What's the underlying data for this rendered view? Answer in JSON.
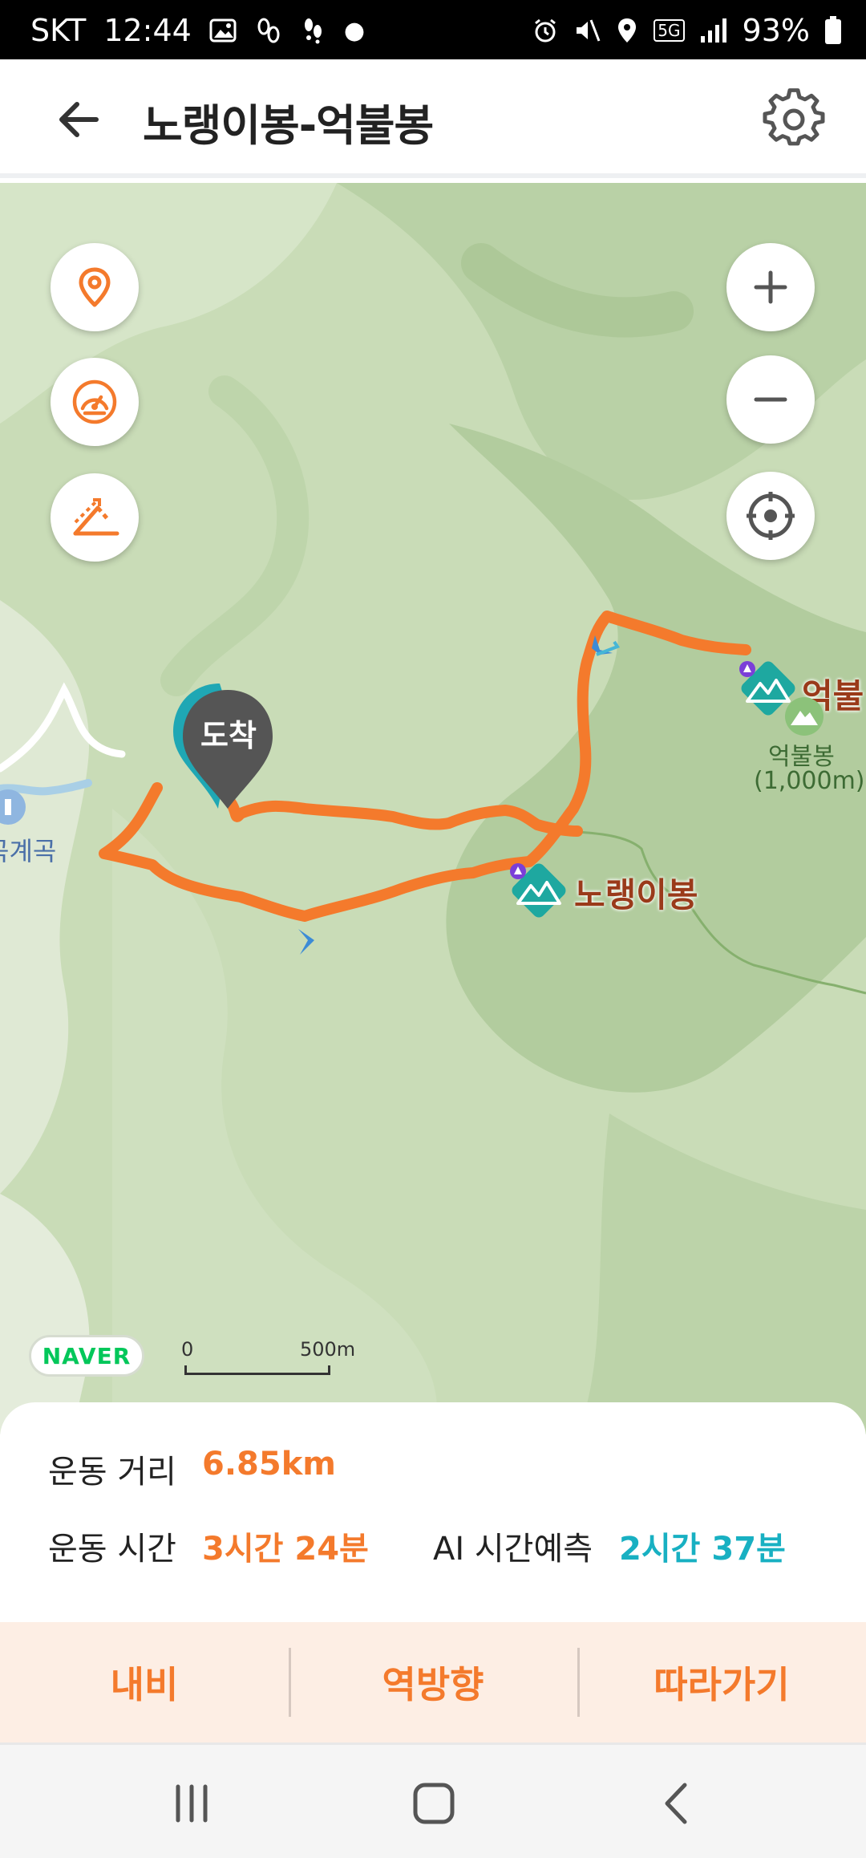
{
  "status_bar": {
    "carrier": "SKT",
    "time": "12:44",
    "network": "5G",
    "battery": "93%"
  },
  "header": {
    "title": "노랭이봉-억불봉",
    "back_icon": "arrow-left-icon",
    "settings_icon": "gear-icon"
  },
  "map": {
    "arrival_pin": "도착",
    "peaks": {
      "noraengi": "노랭이봉",
      "eokbul_short": "억불",
      "eokbul_name": "억불봉",
      "eokbul_height": "(1,000m)"
    },
    "valley": "곡계곡",
    "logo": "NAVER",
    "scale": {
      "zero": "0",
      "max": "500m"
    },
    "route_color": "#f47a2c",
    "buttons": {
      "location_icon": "map-pin-icon",
      "speed_icon": "speedometer-icon",
      "elevation_icon": "elevation-icon",
      "zoom_in_icon": "plus-icon",
      "zoom_out_icon": "minus-icon",
      "locate_icon": "crosshair-icon"
    }
  },
  "stats": {
    "distance_label": "운동 거리",
    "distance_value": "6.85km",
    "time_label": "운동 시간",
    "time_value": "3시간 24분",
    "ai_label": "AI 시간예측",
    "ai_value": "2시간 37분"
  },
  "actions": {
    "navi": "내비",
    "reverse": "역방향",
    "follow": "따라가기"
  },
  "nav_bar": {
    "recents_icon": "recents-icon",
    "home_icon": "home-icon",
    "back_icon": "back-chevron-icon"
  }
}
